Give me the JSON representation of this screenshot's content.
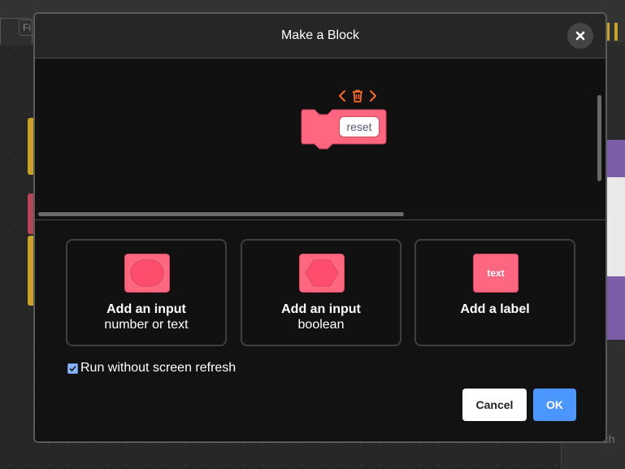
{
  "background": {
    "file_menu_label": "Fi",
    "search_placeholder": "Search"
  },
  "dialog": {
    "title": "Make a Block",
    "close_icon": "close-icon",
    "preview": {
      "block_input_value": "reset",
      "controls": [
        "chevron-left-icon",
        "trash-icon",
        "chevron-right-icon"
      ]
    },
    "options": [
      {
        "title": "Add an input",
        "subtitle": "number or text",
        "icon": "round-input-icon"
      },
      {
        "title": "Add an input",
        "subtitle": "boolean",
        "icon": "boolean-input-icon"
      },
      {
        "title": "Add a label",
        "subtitle": "",
        "icon_text": "text"
      }
    ],
    "run_without_refresh": {
      "label": "Run without screen refresh",
      "checked": true
    },
    "buttons": {
      "cancel": "Cancel",
      "ok": "OK"
    }
  },
  "colors": {
    "block_pink": "#ff6680",
    "block_pink_border": "#d44860",
    "control_orange": "#ff6a23",
    "ok_blue": "#4c97ff"
  }
}
